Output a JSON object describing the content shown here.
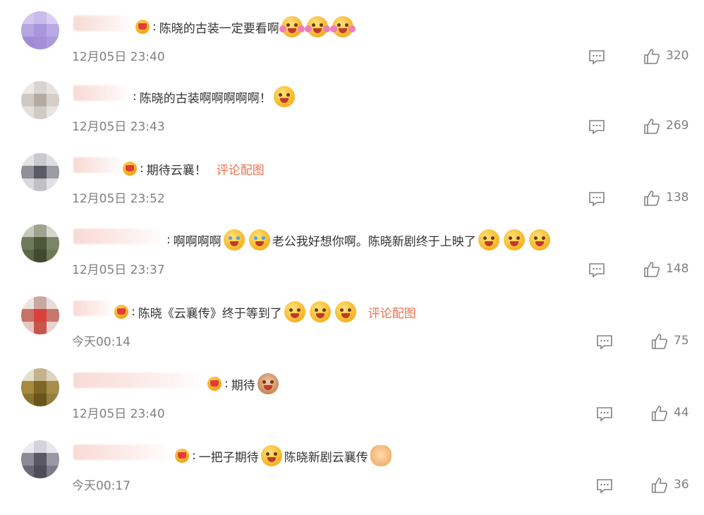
{
  "comments": [
    {
      "text": "陈晓的古装一定要看啊",
      "link": "",
      "time": "12月05日 23:40",
      "likes": "320",
      "avatar": [
        "#d3c8ee",
        "#c7bde8",
        "#d9cff3",
        "#b5a6e3",
        "#a897dd",
        "#b9aae6",
        "#9f8bd9",
        "#a38fd9",
        "#ad9be0"
      ]
    },
    {
      "text": "陈晓的古装啊啊啊啊啊！",
      "link": "",
      "time": "12月05日 23:43",
      "likes": "269",
      "avatar": [
        "#ece9e6",
        "#d8d4cf",
        "#e6e2de",
        "#cfc9c4",
        "#b6aba3",
        "#d6cfc9",
        "#e4e0dc",
        "#d1cbc6",
        "#e8e4e0"
      ]
    },
    {
      "text": "期待云襄！",
      "link": "评论配图",
      "time": "12月05日 23:52",
      "likes": "138",
      "avatar": [
        "#e3e3e6",
        "#c9c9cf",
        "#dfdfe3",
        "#8f8f9a",
        "#5b5b66",
        "#9b9ba4",
        "#d9d9dd",
        "#c0c0c6",
        "#e2e2e5"
      ]
    },
    {
      "text": "啊啊啊啊",
      "text2": "老公我好想你啊。陈晓新剧终于上映了",
      "link": "",
      "time": "12月05日 23:37",
      "likes": "148",
      "avatar": [
        "#c5c9b9",
        "#9ea38e",
        "#d4d6cc",
        "#6f7a5a",
        "#4c5838",
        "#7a8466",
        "#5a6644",
        "#3f4a2e",
        "#6d7a55"
      ]
    },
    {
      "text": "陈晓《云襄传》终于等到了",
      "link": "评论配图",
      "time": "今天00:14",
      "likes": "75",
      "avatar": [
        "#efe3e0",
        "#c9a8a2",
        "#e8dcda",
        "#c77266",
        "#d9423a",
        "#c7776c",
        "#e4c8c2",
        "#c9544a",
        "#e8d3cf"
      ]
    },
    {
      "text": "期待",
      "link": "",
      "time": "12月05日 23:40",
      "likes": "44",
      "avatar": [
        "#e6dfcf",
        "#c4b38a",
        "#ddd3bd",
        "#a7893f",
        "#7e6724",
        "#a58d4c",
        "#8a7431",
        "#6a561c",
        "#94803e"
      ]
    },
    {
      "text": "一把子期待",
      "text2": "陈晓新剧云襄传",
      "link": "",
      "time": "今天00:17",
      "likes": "36",
      "avatar": [
        "#ecebef",
        "#d4d2da",
        "#e8e7ec",
        "#8c8a96",
        "#5a5864",
        "#9a98a4",
        "#6a6876",
        "#4e4c58",
        "#7c7a86"
      ]
    }
  ],
  "colors": {
    "link": "#eb7350",
    "meta": "#808080",
    "text": "#333333"
  }
}
